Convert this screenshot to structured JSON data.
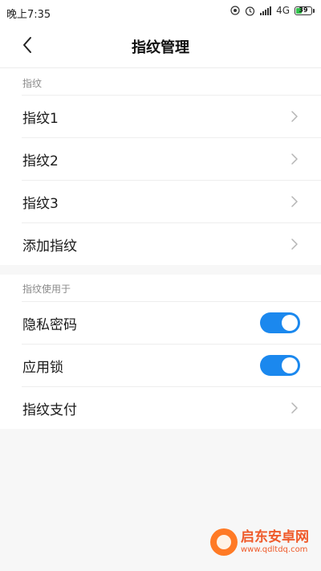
{
  "status_bar": {
    "time": "晚上7:35",
    "network": "4G",
    "battery_level": "39"
  },
  "header": {
    "title": "指纹管理"
  },
  "fingerprints_section": {
    "header": "指纹",
    "items": [
      {
        "label": "指纹1"
      },
      {
        "label": "指纹2"
      },
      {
        "label": "指纹3"
      },
      {
        "label": "添加指纹"
      }
    ]
  },
  "usage_section": {
    "header": "指纹使用于",
    "privacy_password": {
      "label": "隐私密码",
      "enabled": true
    },
    "app_lock": {
      "label": "应用锁",
      "enabled": true
    },
    "fingerprint_pay": {
      "label": "指纹支付"
    }
  },
  "watermark": {
    "title": "启东安卓网",
    "url": "www.qdltdq.com"
  },
  "colors": {
    "toggle_on": "#1b88ee",
    "background": "#f7f7f7",
    "watermark": "#ef5a2a"
  }
}
